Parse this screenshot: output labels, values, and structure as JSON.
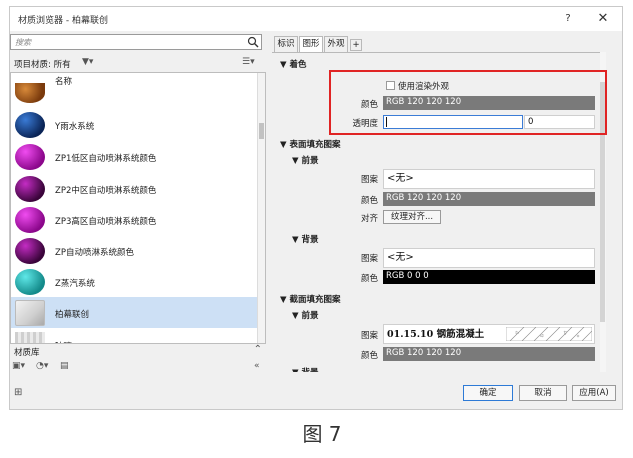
{
  "window": {
    "title": "材质浏览器 - 柏幕联创",
    "help_label": "?",
    "close_label": "✕"
  },
  "search": {
    "placeholder": "搜索"
  },
  "library_header": {
    "label": "项目材质: 所有"
  },
  "list": {
    "column_header": "名称",
    "items": [
      {
        "label": "Y雨水系统",
        "icon": "blue-sphere"
      },
      {
        "label": "ZP1低区自动喷淋系统颜色",
        "icon": "magenta-sphere"
      },
      {
        "label": "ZP2中区自动喷淋系统颜色",
        "icon": "purple-sphere"
      },
      {
        "label": "ZP3高区自动喷淋系统颜色",
        "icon": "magenta-sphere"
      },
      {
        "label": "ZP自动喷淋系统颜色",
        "icon": "purple-sphere"
      },
      {
        "label": "Z蒸汽系统",
        "icon": "teal-sphere"
      },
      {
        "label": "柏幕联创",
        "icon": "box"
      },
      {
        "label": "玻璃",
        "icon": "stripe"
      }
    ]
  },
  "library_bar": {
    "label": "材质库"
  },
  "tabs": [
    {
      "label": "标识"
    },
    {
      "label": "图形"
    },
    {
      "label": "外观"
    },
    {
      "label": "+"
    }
  ],
  "shading": {
    "title": "着色",
    "use_render_label": "使用渲染外观",
    "color_label": "颜色",
    "color_value": "RGB 120 120 120",
    "transparency_label": "透明度",
    "transparency_value": "0"
  },
  "surface_pattern": {
    "title": "表面填充图案",
    "foreground_title": "前景",
    "pattern_label": "图案",
    "pattern_value": "<无>",
    "color_label": "颜色",
    "color_value": "RGB 120 120 120",
    "align_label": "对齐",
    "align_value": "纹理对齐...",
    "background_title": "背景",
    "bg_pattern_value": "<无>",
    "bg_color_value": "RGB 0 0 0"
  },
  "cut_pattern": {
    "title": "截面填充图案",
    "foreground_title": "前景",
    "pattern_label": "图案",
    "pattern_value": "01.15.10 钢筋混凝土",
    "color_label": "颜色",
    "color_value": "RGB 120 120 120",
    "background_title": "背景"
  },
  "footer": {
    "ok_label": "确定",
    "cancel_label": "取消",
    "apply_label": "应用(A)"
  },
  "caption": "图 7",
  "colors": {
    "highlight_border": "#e02424",
    "selected_row": "#cde0f5",
    "gray_field": "#7a7a7a"
  }
}
